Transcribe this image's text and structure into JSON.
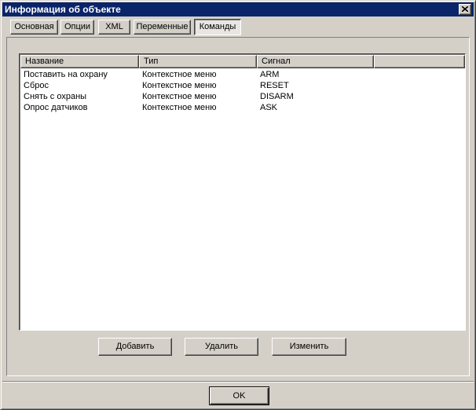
{
  "window": {
    "title": "Информация об объекте"
  },
  "tabs": [
    {
      "label": "Основная",
      "active": false
    },
    {
      "label": "Опции",
      "active": false
    },
    {
      "label": "XML",
      "active": false
    },
    {
      "label": "Переменные",
      "active": false
    },
    {
      "label": "Команды",
      "active": true
    }
  ],
  "list": {
    "columns": [
      "Название",
      "Тип",
      "Сигнал",
      ""
    ],
    "rows": [
      {
        "name": "Поставить на охрану",
        "type": "Контекстное меню",
        "signal": "ARM"
      },
      {
        "name": "Сброс",
        "type": "Контекстное меню",
        "signal": "RESET"
      },
      {
        "name": "Снять с охраны",
        "type": "Контекстное меню",
        "signal": "DISARM"
      },
      {
        "name": "Опрос датчиков",
        "type": "Контекстное меню",
        "signal": "ASK"
      }
    ]
  },
  "buttons": {
    "add": "Добавить",
    "delete": "Удалить",
    "edit": "Изменить",
    "ok": "OK"
  },
  "icons": {
    "close": "close-icon"
  },
  "colors": {
    "titlebar": "#0a246a",
    "face": "#d4d0c8"
  }
}
